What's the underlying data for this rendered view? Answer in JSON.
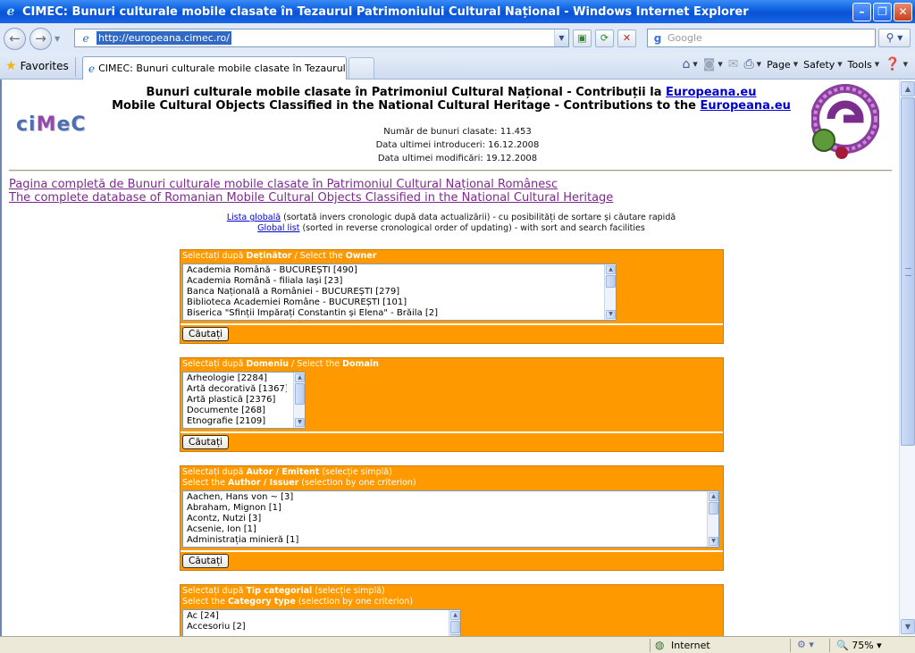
{
  "window": {
    "title": "CIMEC: Bunuri culturale mobile clasate în Tezaurul Patrimoniului Cultural Național - Windows Internet Explorer",
    "minimize": "–",
    "maximize": "❐",
    "close": "✕"
  },
  "address": {
    "url": "http://europeana.cimec.ro/",
    "search_placeholder": "Google"
  },
  "tabs": {
    "favorites_label": "Favorites",
    "active_tab": "CIMEC: Bunuri culturale mobile clasate în Tezaurul Pat..."
  },
  "commandbar": {
    "page": "Page",
    "safety": "Safety",
    "tools": "Tools"
  },
  "page": {
    "logo_text_left": "ci",
    "logo_text_accent": "M",
    "logo_text_right": "eC",
    "header_ro_prefix": "Bunuri culturale mobile clasate în Patrimoniul Cultural Național - Contribuții la ",
    "header_en_prefix": "Mobile Cultural Objects Classified in the National Cultural Heritage - Contributions to the ",
    "header_link": "Europeana.eu",
    "stats": {
      "count": "Număr de bunuri clasate: 11.453",
      "last_added": "Data ultimei introduceri: 16.12.2008",
      "last_modified": "Data ultimei modificări: 19.12.2008"
    },
    "full_db_ro": "Pagina completă de Bunuri culturale mobile clasate în Patrimoniul Cultural Național Românesc",
    "full_db_en": "The complete database of Romanian Mobile Cultural Objects Classified in the National Cultural Heritage",
    "lista_globala": "Lista globală",
    "lista_globala_desc": " (sortată invers cronologic după data actualizării) - cu posibilități de sortare și căutare rapidă",
    "global_list": "Global list",
    "global_list_desc": " (sorted in reverse cronological order of updating) - with sort and search facilities"
  },
  "filters": {
    "search_button": "Căutați",
    "owner": {
      "head_pre": "Selectați după ",
      "head_bold_ro": "Deținător",
      "head_mid": " / Select the ",
      "head_bold_en": "Owner",
      "items": [
        "Academia Română - BUCUREȘTI [490]",
        "Academia Română - filiala Iași [23]",
        "Banca Națională a României - BUCUREȘTI [279]",
        "Biblioteca Academiei Române - BUCUREȘTI [101]",
        "Biserica \"Sfinții Împărați Constantin și Elena\" - Brăila [2]"
      ]
    },
    "domain": {
      "head_pre": "Selectați după ",
      "head_bold_ro": "Domeniu",
      "head_mid": " / Select the ",
      "head_bold_en": "Domain",
      "items": [
        "Arheologie [2284]",
        "Artă decorativă [1367]",
        "Artă plastică [2376]",
        "Documente [268]",
        "Etnografie [2109]"
      ]
    },
    "author": {
      "line1_pre": "Selectați după ",
      "line1_bold": "Autor / Emitent",
      "line1_post": " (selecție simplă)",
      "line2_pre": "Select the ",
      "line2_bold": "Author / Issuer",
      "line2_post": " (selection by one criterion)",
      "items": [
        "Aachen, Hans von ~ [3]",
        "Abraham, Mignon [1]",
        "Acontz, Nutzi [3]",
        "Acsenie, Ion [1]",
        "Administrația minieră [1]"
      ]
    },
    "category": {
      "line1_pre": "Selectați după ",
      "line1_bold": "Tip categorial",
      "line1_post": " (selecție simplă)",
      "line2_pre": "Select the ",
      "line2_bold": "Category type",
      "line2_post": " (selection by one criterion)",
      "items": [
        "Ac [24]",
        "Accesoriu [2]"
      ]
    }
  },
  "status": {
    "zone": "Internet",
    "zoom": "75%"
  }
}
